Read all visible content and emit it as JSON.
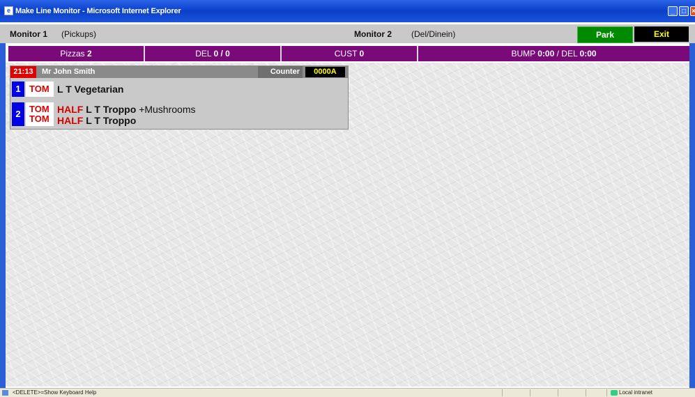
{
  "window": {
    "title": "Make Line Monitor - Microsoft Internet Explorer"
  },
  "monitors": [
    {
      "label": "Monitor 1",
      "sub": "(Pickups)"
    },
    {
      "label": "Monitor 2",
      "sub": "(Del/Dinein)"
    }
  ],
  "buttons": {
    "park": "Park",
    "exit": "Exit"
  },
  "stats": {
    "pizzas_label": "Pizzas",
    "pizzas_value": "2",
    "del_label": "DEL",
    "del_value": "0 / 0",
    "cust_label": "CUST",
    "cust_value": "0",
    "bump_label": "BUMP",
    "bump_value": "0:00",
    "bump_del_label": "/ DEL",
    "bump_del_value": "0:00"
  },
  "order": {
    "time": "21:13",
    "customer": "Mr John Smith",
    "type": "Counter",
    "id": "0000A",
    "items": [
      {
        "num": "1",
        "lines": [
          {
            "sauce": "TOM",
            "half": "",
            "name": "L T Vegetarian",
            "extra": ""
          }
        ]
      },
      {
        "num": "2",
        "lines": [
          {
            "sauce": "TOM",
            "half": "HALF",
            "name": "L T Troppo",
            "extra": "+Mushrooms"
          },
          {
            "sauce": "TOM",
            "half": "HALF",
            "name": "L T Troppo",
            "extra": ""
          }
        ]
      }
    ]
  },
  "statusbar": {
    "message": "<DELETE>=Show Keyboard Help",
    "zone": "Local intranet"
  },
  "colors": {
    "purple": "#7a0a7a",
    "park_green": "#008a00",
    "exit_yellow": "#ffff00",
    "alert_red": "#e00000",
    "item_blue": "#0000e6"
  }
}
